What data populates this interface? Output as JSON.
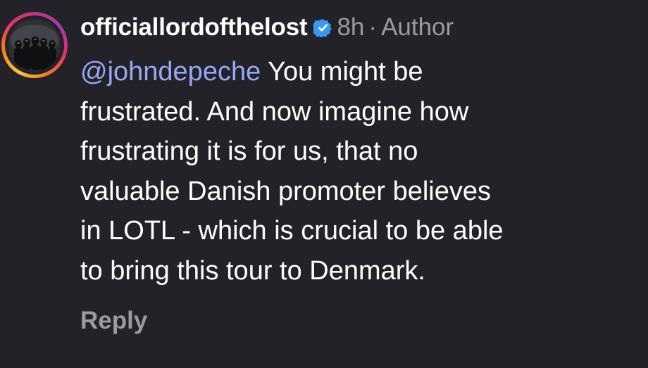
{
  "comment": {
    "username": "officiallordofthelost",
    "time": "8h",
    "separator": "·",
    "role": "Author",
    "mention": "@johndepeche",
    "text_lines": [
      " You might be",
      "frustrated. And now imagine how",
      "frustrating it is for us, that no",
      "valuable Danish promoter believes",
      "in LOTL - which is crucial to be able",
      "to bring this tour to Denmark."
    ],
    "reply_label": "Reply",
    "icons": {
      "verified": "verified-badge-icon",
      "avatar": "profile-avatar"
    },
    "colors": {
      "background": "#222228",
      "mention": "#96a9f3",
      "verified": "#3897f0",
      "secondary_text": "#9a9aa2"
    }
  }
}
